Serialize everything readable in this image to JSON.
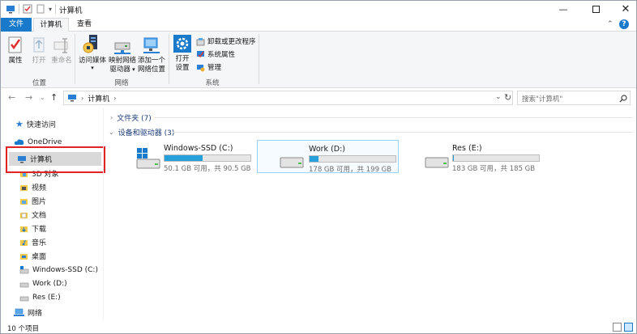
{
  "window": {
    "title": "计算机"
  },
  "colors": {
    "accent": "#1979ca",
    "selection": "#d9d9d9",
    "highlight_box": "#e02424",
    "bar_fill": "#26a0da"
  },
  "ribbon": {
    "tabs": [
      {
        "label": "文件"
      },
      {
        "label": "计算机"
      },
      {
        "label": "查看"
      }
    ],
    "location_group": {
      "label": "位置",
      "properties": "属性",
      "open": "打开",
      "rename": "重命名"
    },
    "network_group": {
      "label": "网络",
      "access_media": "访问媒体",
      "map_drive_line1": "映射网络",
      "map_drive_line2": "驱动器",
      "add_location_line1": "添加一个",
      "add_location_line2": "网络位置"
    },
    "system_group": {
      "label": "系统",
      "open_settings_line1": "打开",
      "open_settings_line2": "设置",
      "uninstall": "卸载或更改程序",
      "system_properties": "系统属性",
      "manage": "管理"
    }
  },
  "address": {
    "path": "计算机",
    "search_placeholder": "搜索\"计算机\""
  },
  "sidebar": {
    "items": [
      {
        "label": "快速访问",
        "icon": "star-icon"
      },
      {
        "label": "OneDrive",
        "icon": "cloud-icon"
      },
      {
        "label": "计算机",
        "icon": "computer-icon",
        "selected": true
      },
      {
        "label": "3D 对象",
        "icon": "cube-folder-icon"
      },
      {
        "label": "视频",
        "icon": "video-folder-icon"
      },
      {
        "label": "图片",
        "icon": "picture-folder-icon"
      },
      {
        "label": "文档",
        "icon": "document-folder-icon"
      },
      {
        "label": "下载",
        "icon": "download-folder-icon"
      },
      {
        "label": "音乐",
        "icon": "music-folder-icon"
      },
      {
        "label": "桌面",
        "icon": "desktop-folder-icon"
      },
      {
        "label": "Windows-SSD (C:)",
        "icon": "drive-icon"
      },
      {
        "label": "Work (D:)",
        "icon": "drive-icon"
      },
      {
        "label": "Res (E:)",
        "icon": "drive-icon"
      },
      {
        "label": "网络",
        "icon": "network-icon"
      }
    ]
  },
  "main": {
    "folders_header": "文件夹 (7)",
    "devices_header": "设备和驱动器 (3)",
    "drives": [
      {
        "name": "Windows-SSD (C:)",
        "free_text": "50.1 GB 可用，共 90.5 GB",
        "used_fraction": 0.446
      },
      {
        "name": "Work (D:)",
        "free_text": "178 GB 可用，共 199 GB",
        "used_fraction": 0.106
      },
      {
        "name": "Res (E:)",
        "free_text": "183 GB 可用，共 185 GB",
        "used_fraction": 0.011
      }
    ]
  },
  "status": {
    "item_count": "10 个项目"
  }
}
